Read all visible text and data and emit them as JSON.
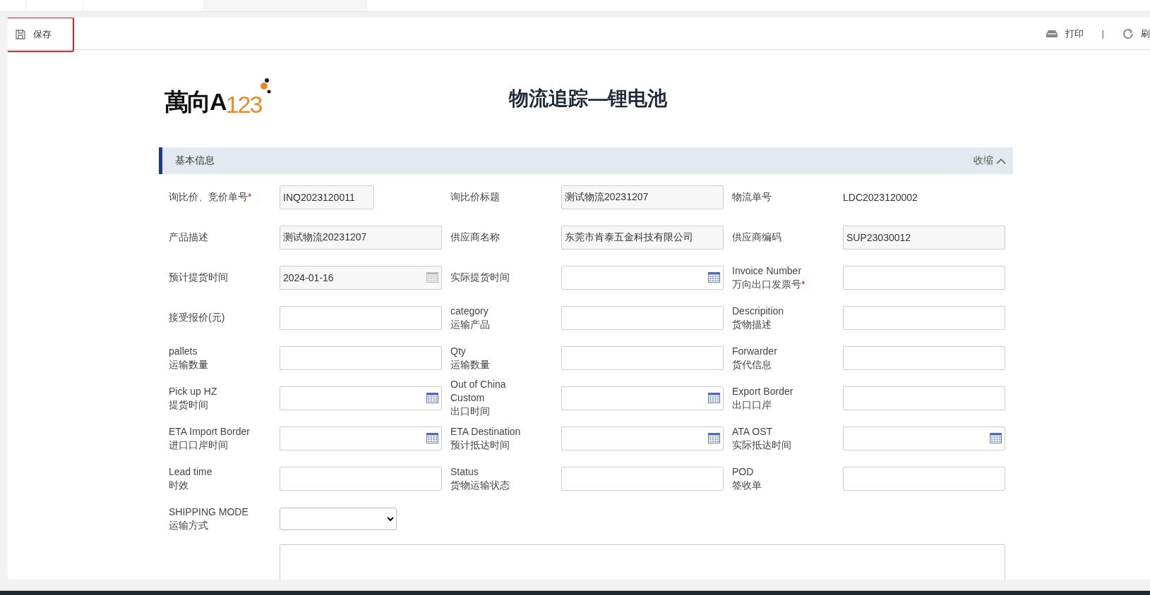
{
  "toolbar": {
    "left": [
      {
        "kind": "save",
        "label": "保存",
        "highlighted": true
      }
    ],
    "separator": "|",
    "right": [
      {
        "kind": "print",
        "label": "打印"
      },
      {
        "kind": "refresh",
        "label": "刷"
      }
    ]
  },
  "logo": {
    "main": "萬向A",
    "accent": "123"
  },
  "title": "物流追踪—锂电池",
  "section": {
    "title": "基本信息",
    "toggle": "收缩",
    "expanded": true
  },
  "required_mark": "*",
  "rows": [
    [
      {
        "label": [
          "询比价、竞价单号"
        ],
        "required": true,
        "kind": "text_short",
        "value": "INQ2023120011",
        "readonly": true
      },
      {
        "label": [
          "询比价标题"
        ],
        "required": false,
        "kind": "text",
        "value": "测试物流20231207",
        "readonly": true
      },
      {
        "label": [
          "物流单号"
        ],
        "required": false,
        "kind": "static",
        "value": "LDC2023120002"
      }
    ],
    [
      {
        "label": [
          "产品描述"
        ],
        "required": false,
        "kind": "text",
        "value": "测试物流20231207",
        "readonly": true
      },
      {
        "label": [
          "供应商名称"
        ],
        "required": false,
        "kind": "text",
        "value": "东莞市肯泰五金科技有限公司",
        "readonly": true
      },
      {
        "label": [
          "供应商编码"
        ],
        "required": false,
        "kind": "text",
        "value": "SUP23030012",
        "readonly": true
      }
    ],
    [
      {
        "label": [
          "预计提货时间"
        ],
        "required": false,
        "kind": "date",
        "value": "2024-01-16",
        "readonly": true
      },
      {
        "label": [
          "实际提货时间"
        ],
        "required": false,
        "kind": "date",
        "readonly": false
      },
      {
        "label": [
          "Invoice Number",
          "万向出口发票号"
        ],
        "required": true,
        "kind": "text",
        "readonly": false
      }
    ],
    [
      {
        "label": [
          "接受报价(元)"
        ],
        "required": false,
        "kind": "text",
        "readonly": false
      },
      {
        "label": [
          "category",
          "运输产品"
        ],
        "required": false,
        "kind": "text",
        "readonly": false
      },
      {
        "label": [
          "Descripition",
          "货物描述"
        ],
        "required": false,
        "kind": "text",
        "readonly": false
      }
    ],
    [
      {
        "label": [
          "pallets",
          "运输数量"
        ],
        "required": false,
        "kind": "text",
        "readonly": false
      },
      {
        "label": [
          "Qty",
          "运输数量"
        ],
        "required": false,
        "kind": "text",
        "readonly": false
      },
      {
        "label": [
          "Forwarder",
          "货代信息"
        ],
        "required": false,
        "kind": "text",
        "readonly": false
      }
    ],
    [
      {
        "label": [
          "Pick up HZ",
          "提货时间"
        ],
        "required": false,
        "kind": "date",
        "readonly": false
      },
      {
        "label": [
          "Out of China",
          "Custom",
          "出口时间"
        ],
        "required": false,
        "kind": "date",
        "readonly": false
      },
      {
        "label": [
          "Export Border",
          "出口口岸"
        ],
        "required": false,
        "kind": "text",
        "readonly": false
      }
    ],
    [
      {
        "label": [
          "ETA Import Border",
          "进口口岸时间"
        ],
        "required": false,
        "kind": "date",
        "readonly": false
      },
      {
        "label": [
          "ETA Destination",
          "预计抵达时间"
        ],
        "required": false,
        "kind": "date",
        "readonly": false
      },
      {
        "label": [
          "ATA OST",
          "实际抵达时间"
        ],
        "required": false,
        "kind": "date",
        "readonly": false
      }
    ],
    [
      {
        "label": [
          "Lead time",
          "时效"
        ],
        "required": false,
        "kind": "text",
        "readonly": false
      },
      {
        "label": [
          "Status",
          "货物运输状态"
        ],
        "required": false,
        "kind": "text",
        "readonly": false
      },
      {
        "label": [
          "POD",
          "签收单"
        ],
        "required": false,
        "kind": "text",
        "readonly": false
      }
    ],
    [
      {
        "label": [
          "SHIPPING MODE",
          "运输方式"
        ],
        "required": false,
        "kind": "select",
        "readonly": false
      }
    ],
    [
      {
        "kind": "textarea"
      }
    ]
  ]
}
